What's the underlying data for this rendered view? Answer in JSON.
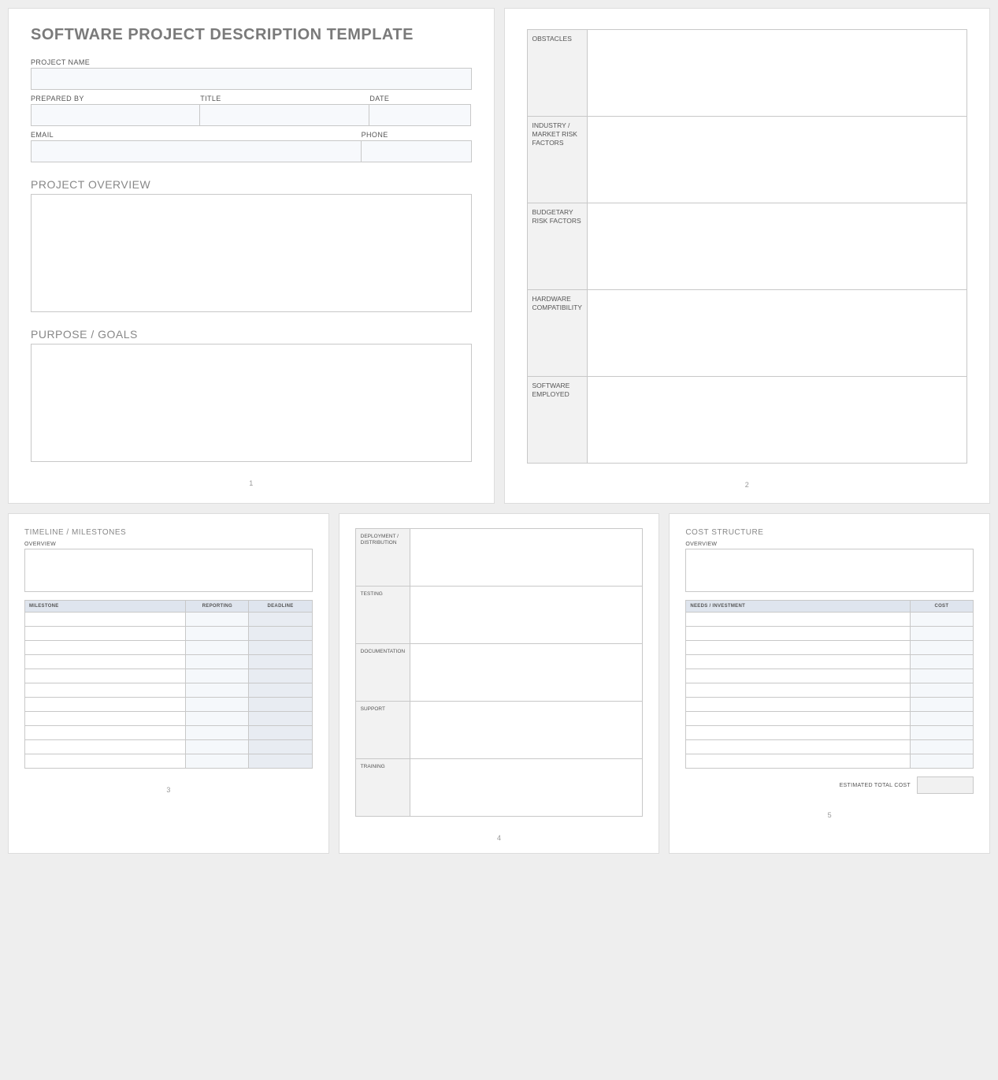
{
  "page1": {
    "title": "SOFTWARE PROJECT DESCRIPTION TEMPLATE",
    "project_name_label": "PROJECT NAME",
    "project_name": "",
    "prepared_by_label": "PREPARED BY",
    "prepared_by": "",
    "title_label": "TITLE",
    "prepared_title": "",
    "date_label": "DATE",
    "date": "",
    "email_label": "EMAIL",
    "email": "",
    "phone_label": "PHONE",
    "phone": "",
    "overview_heading": "PROJECT OVERVIEW",
    "overview": "",
    "goals_heading": "PURPOSE / GOALS",
    "goals": "",
    "page_number": "1"
  },
  "page2": {
    "rows": [
      {
        "label": "OBSTACLES",
        "value": ""
      },
      {
        "label": "INDUSTRY / MARKET RISK FACTORS",
        "value": ""
      },
      {
        "label": "BUDGETARY RISK FACTORS",
        "value": ""
      },
      {
        "label": "HARDWARE COMPATIBILITY",
        "value": ""
      },
      {
        "label": "SOFTWARE EMPLOYED",
        "value": ""
      }
    ],
    "page_number": "2"
  },
  "page3": {
    "heading": "TIMELINE / MILESTONES",
    "overview_label": "OVERVIEW",
    "overview": "",
    "columns": [
      "MILESTONE",
      "REPORTING",
      "DEADLINE"
    ],
    "rows": [
      {
        "milestone": "",
        "reporting": "",
        "deadline": ""
      },
      {
        "milestone": "",
        "reporting": "",
        "deadline": ""
      },
      {
        "milestone": "",
        "reporting": "",
        "deadline": ""
      },
      {
        "milestone": "",
        "reporting": "",
        "deadline": ""
      },
      {
        "milestone": "",
        "reporting": "",
        "deadline": ""
      },
      {
        "milestone": "",
        "reporting": "",
        "deadline": ""
      },
      {
        "milestone": "",
        "reporting": "",
        "deadline": ""
      },
      {
        "milestone": "",
        "reporting": "",
        "deadline": ""
      },
      {
        "milestone": "",
        "reporting": "",
        "deadline": ""
      },
      {
        "milestone": "",
        "reporting": "",
        "deadline": ""
      },
      {
        "milestone": "",
        "reporting": "",
        "deadline": ""
      }
    ],
    "page_number": "3"
  },
  "page4": {
    "rows": [
      {
        "label": "DEPLOYMENT / DISTRIBUTION",
        "value": ""
      },
      {
        "label": "TESTING",
        "value": ""
      },
      {
        "label": "DOCUMENTATION",
        "value": ""
      },
      {
        "label": "SUPPORT",
        "value": ""
      },
      {
        "label": "TRAINING",
        "value": ""
      }
    ],
    "page_number": "4"
  },
  "page5": {
    "heading": "COST STRUCTURE",
    "overview_label": "OVERVIEW",
    "overview": "",
    "columns": [
      "NEEDS / INVESTMENT",
      "COST"
    ],
    "rows": [
      {
        "need": "",
        "cost": ""
      },
      {
        "need": "",
        "cost": ""
      },
      {
        "need": "",
        "cost": ""
      },
      {
        "need": "",
        "cost": ""
      },
      {
        "need": "",
        "cost": ""
      },
      {
        "need": "",
        "cost": ""
      },
      {
        "need": "",
        "cost": ""
      },
      {
        "need": "",
        "cost": ""
      },
      {
        "need": "",
        "cost": ""
      },
      {
        "need": "",
        "cost": ""
      },
      {
        "need": "",
        "cost": ""
      }
    ],
    "total_label": "ESTIMATED TOTAL COST",
    "total_value": "",
    "page_number": "5"
  }
}
